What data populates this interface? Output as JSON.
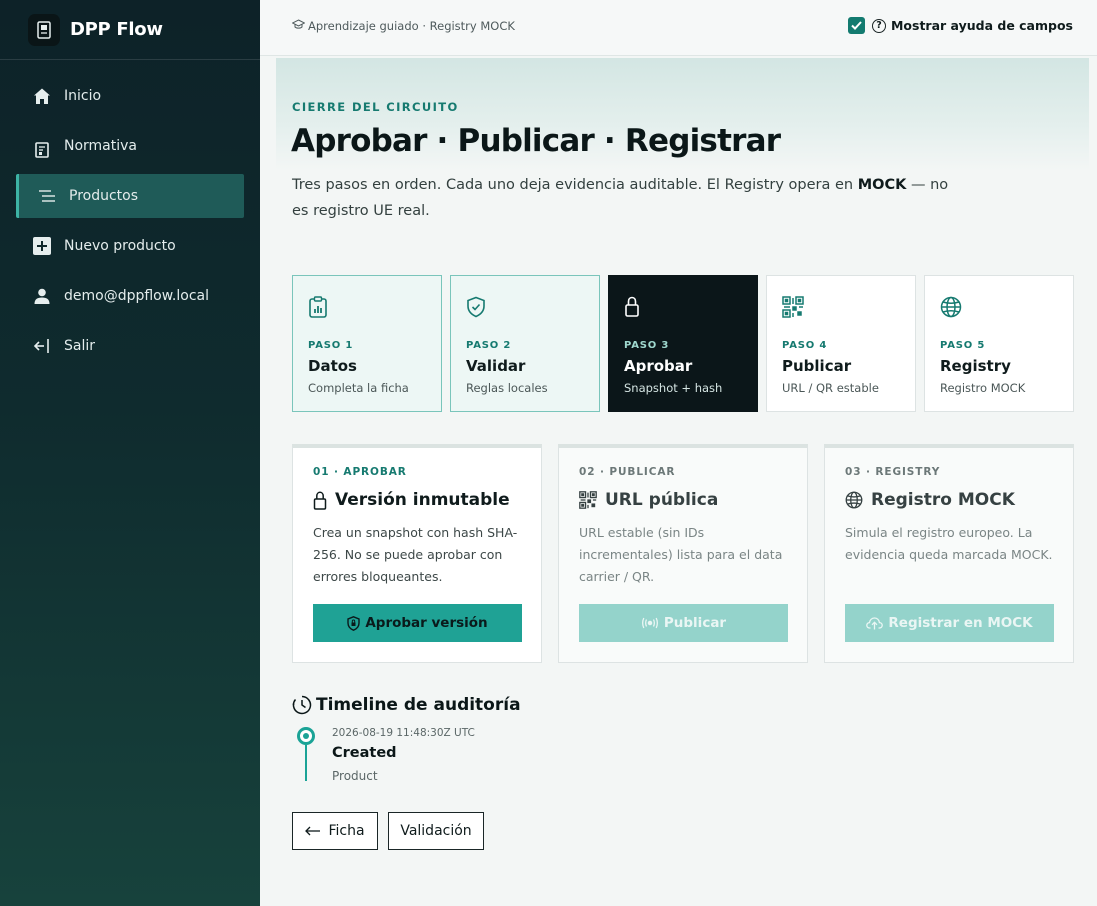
{
  "app": {
    "name": "DPP Flow"
  },
  "sidebar": {
    "items": [
      {
        "label": "Inicio",
        "icon": "home-icon"
      },
      {
        "label": "Normativa",
        "icon": "book-icon"
      },
      {
        "label": "Productos",
        "icon": "list-icon",
        "active": true
      },
      {
        "label": "Nuevo producto",
        "icon": "plus-square-icon"
      },
      {
        "label": "demo@dppflow.local",
        "icon": "user-icon"
      },
      {
        "label": "Salir",
        "icon": "logout-icon"
      }
    ]
  },
  "topbar": {
    "breadcrumb": "Aprendizaje guiado · Registry MOCK",
    "help_label": "Mostrar ayuda de campos",
    "help_checked": true
  },
  "hero": {
    "eyebrow": "CIERRE DEL CIRCUITO",
    "title": "Aprobar · Publicar · Registrar",
    "lead_part1": "Tres pasos en orden. Cada uno deja evidencia auditable. El Registry opera en ",
    "lead_bold": "MOCK",
    "lead_part2": " — no es registro UE real."
  },
  "steps": [
    {
      "num": "PASO 1",
      "name": "Datos",
      "desc": "Completa la ficha",
      "state": "done",
      "icon": "clipboard-chart-icon"
    },
    {
      "num": "PASO 2",
      "name": "Validar",
      "desc": "Reglas locales",
      "state": "done",
      "icon": "shield-check-icon"
    },
    {
      "num": "PASO 3",
      "name": "Aprobar",
      "desc": "Snapshot + hash",
      "state": "current",
      "icon": "lock-icon"
    },
    {
      "num": "PASO 4",
      "name": "Publicar",
      "desc": "URL / QR estable",
      "state": "pending",
      "icon": "qr-code-icon"
    },
    {
      "num": "PASO 5",
      "name": "Registry",
      "desc": "Registro MOCK",
      "state": "pending",
      "icon": "globe-icon"
    }
  ],
  "cards": [
    {
      "kicker": "01 · APROBAR",
      "title": "Versión inmutable",
      "desc": "Crea un snapshot con hash SHA-256. No se puede aprobar con errores bloqueantes.",
      "button": "Aprobar versión",
      "enabled": true
    },
    {
      "kicker": "02 · PUBLICAR",
      "title": "URL pública",
      "desc": "URL estable (sin IDs incrementales) lista para el data carrier / QR.",
      "button": "Publicar",
      "enabled": false
    },
    {
      "kicker": "03 · REGISTRY",
      "title": "Registro MOCK",
      "desc": "Simula el registro europeo. La evidencia queda marcada MOCK.",
      "button": "Registrar en MOCK",
      "enabled": false
    }
  ],
  "timeline": {
    "title": "Timeline de auditoría",
    "events": [
      {
        "time": "2026-08-19 11:48:30Z UTC",
        "event": "Created",
        "entity": "Product"
      }
    ]
  },
  "footer_buttons": {
    "back": "Ficha",
    "validation": "Validación"
  },
  "colors": {
    "accent": "#1fa295",
    "accent_dark": "#167a70",
    "sidebar": "#0f2b2e",
    "current_step": "#0b1619"
  }
}
